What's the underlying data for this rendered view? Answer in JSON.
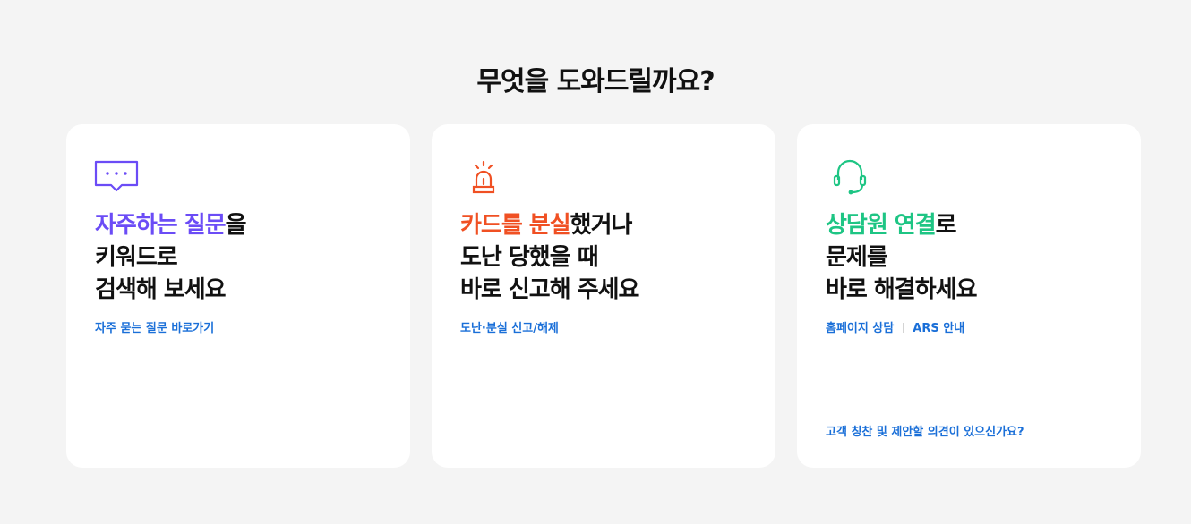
{
  "page": {
    "title": "무엇을 도와드릴까요?"
  },
  "colors": {
    "faq_accent": "#6b4cf6",
    "lost_accent": "#f05023",
    "consult_accent": "#1ec584",
    "link": "#1a6fd8",
    "background": "#f4f4f4"
  },
  "cards": [
    {
      "icon": "speech-bubble-icon",
      "highlight": "자주하는 질문",
      "line1_rest": "을",
      "line2": "키워드로",
      "line3": "검색해 보세요",
      "links": [
        "자주 묻는 질문 바로가기"
      ]
    },
    {
      "icon": "siren-icon",
      "highlight": "카드를 분실",
      "line1_rest": "했거나",
      "line2": "도난 당했을 때",
      "line3": "바로 신고해 주세요",
      "links": [
        "도난·분실 신고/해제"
      ]
    },
    {
      "icon": "headset-icon",
      "highlight": "상담원 연결",
      "line1_rest": "로",
      "line2": "문제를",
      "line3": "바로 해결하세요",
      "links": [
        "홈페이지 상담",
        "ARS 안내"
      ],
      "bottom_link": "고객 칭찬 및 제안할 의견이 있으신가요?"
    }
  ]
}
